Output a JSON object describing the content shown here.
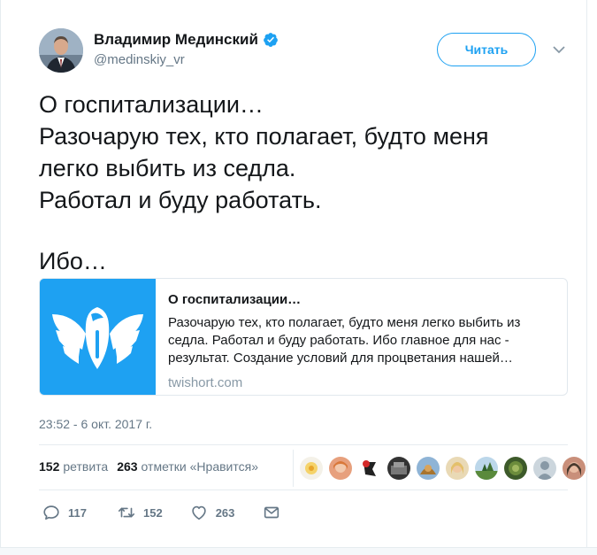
{
  "author": {
    "name": "Владимир Мединский",
    "handle": "@medinskiy_vr",
    "verified": true
  },
  "follow_label": "Читать",
  "tweet": {
    "lines": [
      "О госпитализации…",
      "Разочарую тех, кто полагает, будто меня",
      "легко выбить из седла.",
      "Работал и буду работать."
    ],
    "last_line": "Ибо…"
  },
  "card": {
    "title": "О госпитализации…",
    "desc_lines": [
      "Разочарую тех, кто полагает, будто меня легко выбить из",
      "седла. Работал и буду работать. Ибо главное для нас -",
      "результат. Создание условий для процветания нашей…"
    ],
    "domain": "twishort.com"
  },
  "timestamp": "23:52 - 6 окт. 2017 г.",
  "stats": {
    "retweets_count": "152",
    "retweets_label": "ретвита",
    "likes_count": "263",
    "likes_label": "отметки «Нравится»"
  },
  "liker_avatar_count": 10,
  "actions": {
    "replies": "117",
    "retweets": "152",
    "likes": "263"
  },
  "colors": {
    "accent": "#1da1f2",
    "text": "#14171a",
    "muted": "#657786",
    "card_image_bg": "#1ea1f2"
  }
}
